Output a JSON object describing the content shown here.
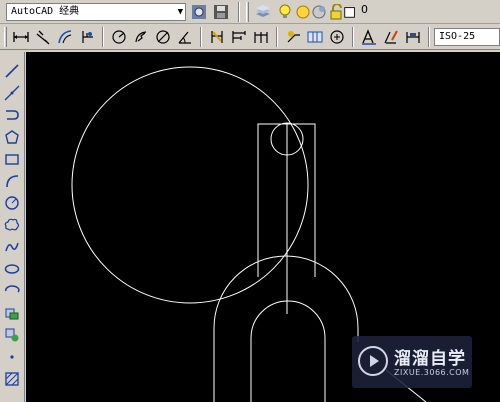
{
  "toolbar_top": {
    "workspace_combo": "AutoCAD 经典",
    "layer_name": "0"
  },
  "toolbar_dim": {
    "dimstyle_combo": "ISO-25"
  },
  "left_tools": [
    "line",
    "construction-line",
    "polyline",
    "polygon",
    "rectangle",
    "arc",
    "circle",
    "revision-cloud",
    "spline",
    "ellipse",
    "ellipse-arc",
    "insert-block",
    "make-block",
    "point",
    "hatch"
  ],
  "watermark": {
    "brand_cn": "溜溜自学",
    "brand_url": "ZIXUE.3066.COM"
  },
  "colors": {
    "ui_face": "#d4d0c8",
    "canvas_bg": "#000000",
    "geometry_stroke": "#ffffff"
  }
}
